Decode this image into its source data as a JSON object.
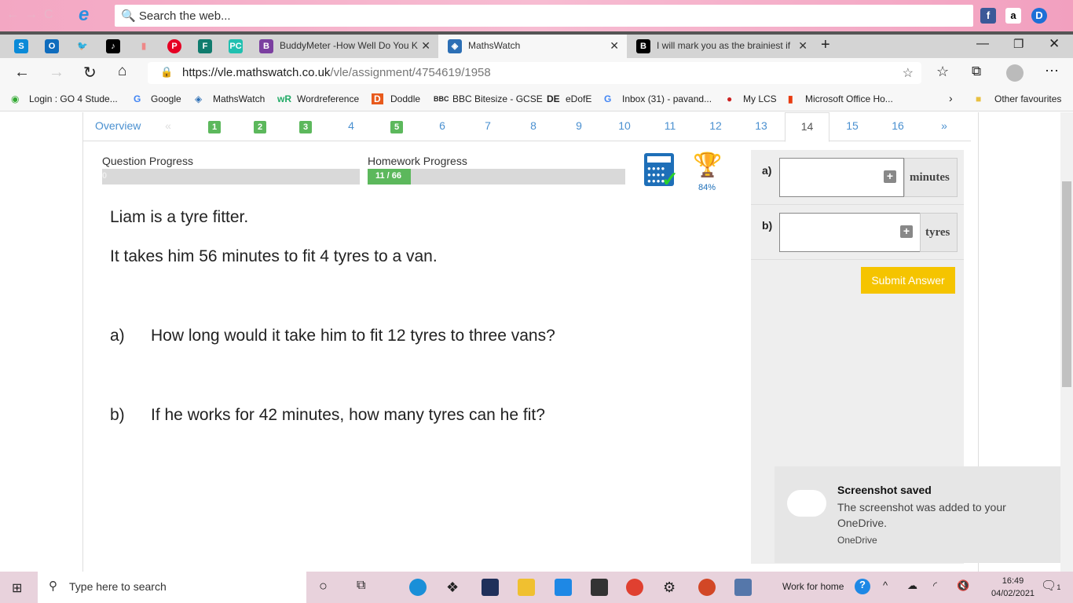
{
  "ie_toolbar": {
    "search_placeholder": "Search the web..."
  },
  "browser": {
    "tabs": [
      {
        "label": "BuddyMeter -How Well Do You K"
      },
      {
        "label": "MathsWatch",
        "active": true
      },
      {
        "label": "I will mark you as the brainiest if"
      }
    ],
    "url_host": "https://vle.mathswatch.co.uk",
    "url_path": "/vle/assignment/4754619/1958",
    "bookmarks": [
      "Login : GO 4 Stude...",
      "Google",
      "MathsWatch",
      "Wordreference",
      "Doddle",
      "BBC Bitesize - GCSE",
      "eDofE",
      "Inbox (31) - pavand...",
      "My LCS",
      "Microsoft Office Ho..."
    ],
    "other_favourites": "Other favourites"
  },
  "qnav": {
    "overview": "Overview",
    "prev": "«",
    "next": "»",
    "items": [
      "1",
      "2",
      "3",
      "4",
      "5",
      "6",
      "7",
      "8",
      "9",
      "10",
      "11",
      "12",
      "13",
      "14",
      "15",
      "16"
    ],
    "done": [
      1,
      2,
      3,
      5
    ],
    "active": 14
  },
  "progress": {
    "question_label": "Question Progress",
    "question_value": "0",
    "question_fraction": 0,
    "homework_label": "Homework Progress",
    "homework_value": "11 / 66",
    "homework_fraction": 0.1667,
    "trophy_percent": "84%"
  },
  "question": {
    "intro1": "Liam is a tyre fitter.",
    "intro2": "It takes him 56 minutes to fit 4 tyres to a van.",
    "a_label": "a)",
    "a_text": "How long would it take him to fit 12 tyres to three vans?",
    "b_label": "b)",
    "b_text": "If he works for 42 minutes, how many tyres can he fit?"
  },
  "answers": {
    "a_label": "a)",
    "a_unit": "minutes",
    "a_value": "",
    "b_label": "b)",
    "b_unit": "tyres",
    "b_value": "",
    "submit": "Submit Answer"
  },
  "toast": {
    "title": "Screenshot saved",
    "body": "The screenshot was added to your OneDrive.",
    "source": "OneDrive"
  },
  "taskbar": {
    "search_placeholder": "Type here to search",
    "toolbar_label": "Work for home",
    "time": "16:49",
    "date": "04/02/2021",
    "notifications": "1"
  }
}
